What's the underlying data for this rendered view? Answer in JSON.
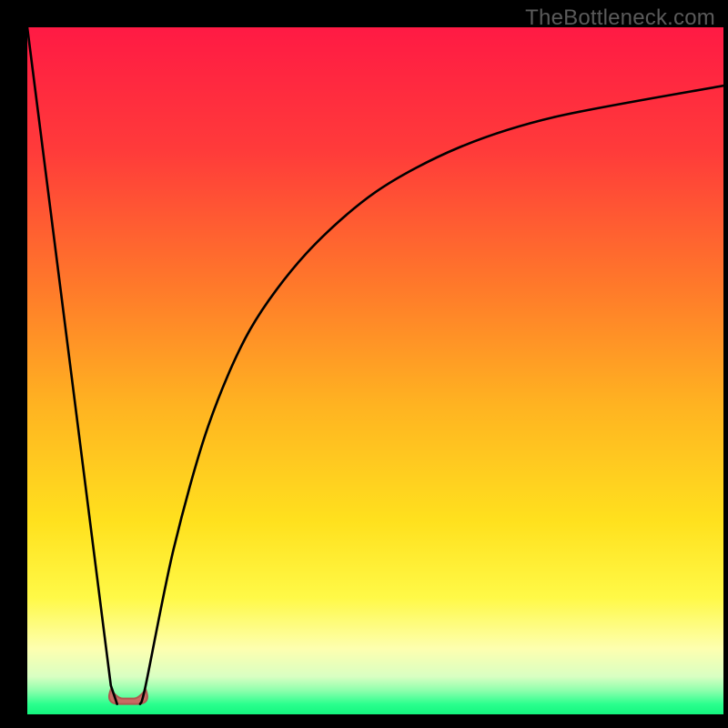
{
  "watermark": "TheBottleneck.com",
  "colors": {
    "frame": "#000000",
    "curve": "#000000",
    "bump_fill": "#c96b63",
    "bump_stroke": "#b15850",
    "gradient_stops": [
      {
        "offset": 0.0,
        "color": "#ff1a44"
      },
      {
        "offset": 0.18,
        "color": "#ff3b3a"
      },
      {
        "offset": 0.38,
        "color": "#ff7a2a"
      },
      {
        "offset": 0.55,
        "color": "#ffb321"
      },
      {
        "offset": 0.72,
        "color": "#ffe11e"
      },
      {
        "offset": 0.83,
        "color": "#fff947"
      },
      {
        "offset": 0.905,
        "color": "#fdffb0"
      },
      {
        "offset": 0.945,
        "color": "#d9ffc2"
      },
      {
        "offset": 0.965,
        "color": "#8fffad"
      },
      {
        "offset": 0.985,
        "color": "#2bff8e"
      },
      {
        "offset": 1.0,
        "color": "#14f57e"
      }
    ]
  },
  "chart_data": {
    "type": "line",
    "title": "",
    "xlabel": "",
    "ylabel": "",
    "xlim": [
      0,
      100
    ],
    "ylim": [
      0,
      100
    ],
    "grid": false,
    "series": [
      {
        "name": "left-branch",
        "x": [
          0,
          12.0,
          12.9
        ],
        "values": [
          100,
          4.2,
          1.5
        ]
      },
      {
        "name": "right-branch",
        "x": [
          16.2,
          17.0,
          21,
          26,
          32,
          40,
          50,
          62,
          76,
          100
        ],
        "values": [
          1.5,
          4.2,
          24,
          42,
          56,
          67,
          76,
          82.5,
          87,
          91.5
        ]
      }
    ],
    "annotations": [
      {
        "name": "trough-bump",
        "shape": "rounded-dip",
        "x_range": [
          12.0,
          17.0
        ],
        "y": 1.5
      }
    ]
  }
}
